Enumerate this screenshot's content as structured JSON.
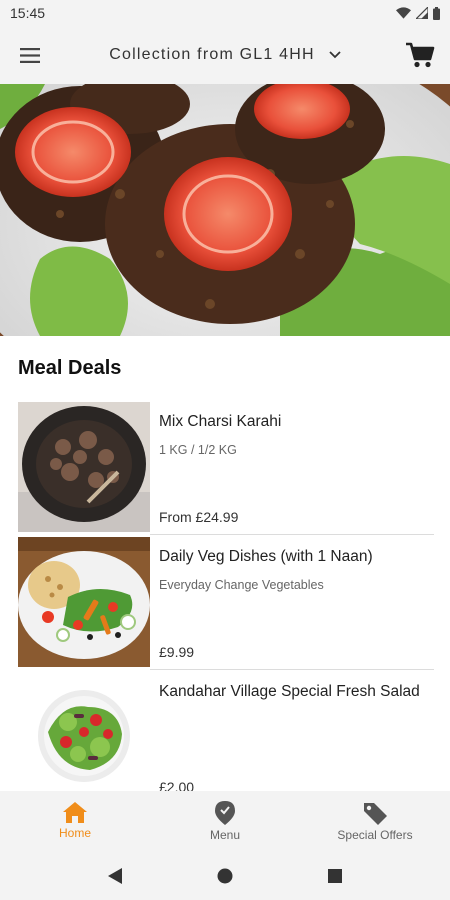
{
  "status_bar": {
    "time": "15:45"
  },
  "app_bar": {
    "title": "Collection from GL1 4HH"
  },
  "section": {
    "title": "Meal Deals"
  },
  "deals": [
    {
      "name": "Mix Charsi Karahi",
      "description": "1 KG / 1/2 KG",
      "price": "From £24.99"
    },
    {
      "name": "Daily Veg Dishes (with 1 Naan)",
      "description": "Everyday Change Vegetables",
      "price": "£9.99"
    },
    {
      "name": "Kandahar Village Special Fresh Salad",
      "description": "",
      "price": "£2.00"
    }
  ],
  "bottom_nav": [
    {
      "label": "Home",
      "icon": "home-icon",
      "active": true
    },
    {
      "label": "Menu",
      "icon": "map-pin-icon",
      "active": false
    },
    {
      "label": "Special Offers",
      "icon": "tag-icon",
      "active": false
    }
  ],
  "colors": {
    "accent": "#f08d1a",
    "bar_bg": "#f3f3f3",
    "divider": "#dcdcdc"
  }
}
